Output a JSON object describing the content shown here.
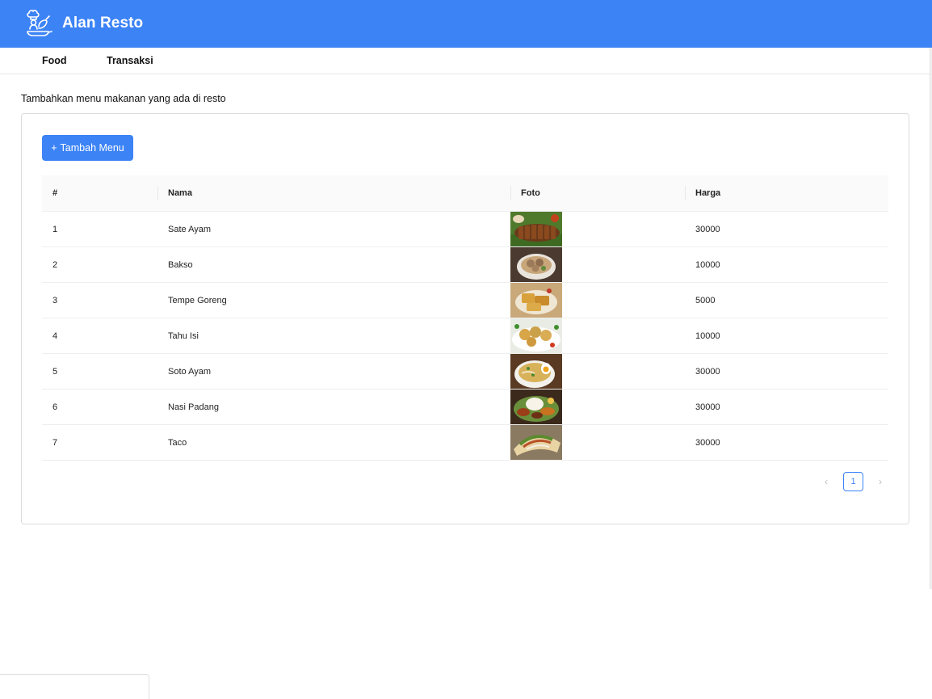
{
  "app": {
    "title": "Alan Resto",
    "brand_color": "#3c83f6",
    "logo_icon": "chef-cooking-icon"
  },
  "nav": {
    "items": [
      {
        "label": "Food"
      },
      {
        "label": "Transaksi"
      }
    ]
  },
  "page": {
    "subtitle": "Tambahkan menu makanan yang ada di resto"
  },
  "toolbar": {
    "add_label": "Tambah Menu",
    "add_icon": "plus"
  },
  "table": {
    "headers": [
      "#",
      "Nama",
      "Foto",
      "Harga"
    ],
    "rows": [
      {
        "no": "1",
        "nama": "Sate Ayam",
        "foto": "sate-ayam-photo",
        "harga": "30000"
      },
      {
        "no": "2",
        "nama": "Bakso",
        "foto": "bakso-photo",
        "harga": "10000"
      },
      {
        "no": "3",
        "nama": "Tempe Goreng",
        "foto": "tempe-goreng-photo",
        "harga": "5000"
      },
      {
        "no": "4",
        "nama": "Tahu Isi",
        "foto": "tahu-isi-photo",
        "harga": "10000"
      },
      {
        "no": "5",
        "nama": "Soto Ayam",
        "foto": "soto-ayam-photo",
        "harga": "30000"
      },
      {
        "no": "6",
        "nama": "Nasi Padang",
        "foto": "nasi-padang-photo",
        "harga": "30000"
      },
      {
        "no": "7",
        "nama": "Taco",
        "foto": "taco-photo",
        "harga": "30000"
      }
    ]
  },
  "pagination": {
    "current_page": "1",
    "prev_icon": "chevron-left-icon",
    "next_icon": "chevron-right-icon"
  }
}
